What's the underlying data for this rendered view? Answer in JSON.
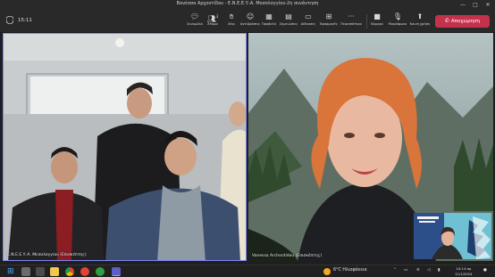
{
  "window": {
    "title": "Βανέσσα Αρχοντίδου - E.N.E.E.Y.-A. Μεσολογγίου-2η συνάντηση",
    "controls": [
      "—",
      "□",
      "✕"
    ]
  },
  "toolbar": {
    "timer": "15:11",
    "buttons": [
      {
        "label": "Συνομιλία",
        "icon": "chat-icon"
      },
      {
        "label": "Άτομα",
        "icon": "people-icon",
        "badge": "3"
      },
      {
        "label": "Χέρι",
        "icon": "raise-hand-icon"
      },
      {
        "label": "Αντιδράσεις",
        "icon": "reactions-icon"
      },
      {
        "label": "Προβολή",
        "icon": "view-icon"
      },
      {
        "label": "Σημειώσεις",
        "icon": "notes-icon"
      },
      {
        "label": "Αίθουσες",
        "icon": "rooms-icon"
      },
      {
        "label": "Εφαρμογές",
        "icon": "apps-icon"
      },
      {
        "label": "Περισσότερα",
        "icon": "more-icon"
      },
      {
        "label": "Κάμερα",
        "icon": "camera-icon"
      },
      {
        "label": "Μικρόφωνο",
        "icon": "microphone-icon"
      },
      {
        "label": "Κοινή χρήση",
        "icon": "share-icon"
      }
    ],
    "leave_label": "Αποχώρηση"
  },
  "stage": {
    "left_name": "E.N.E.E.Y.-A. Μεσολογγίου (Επισκέπτης)",
    "right_name": "Vanessa Archontidou (Επισκέπτης)",
    "pip_logo": "teacher-pip-logo"
  },
  "taskbar": {
    "weather": "6°C Ηλιοφάνεια",
    "time": "10:14 πμ",
    "date": "11/1/2024",
    "colors": {
      "accent": "#7f85f5",
      "leave": "#c4314b"
    }
  }
}
